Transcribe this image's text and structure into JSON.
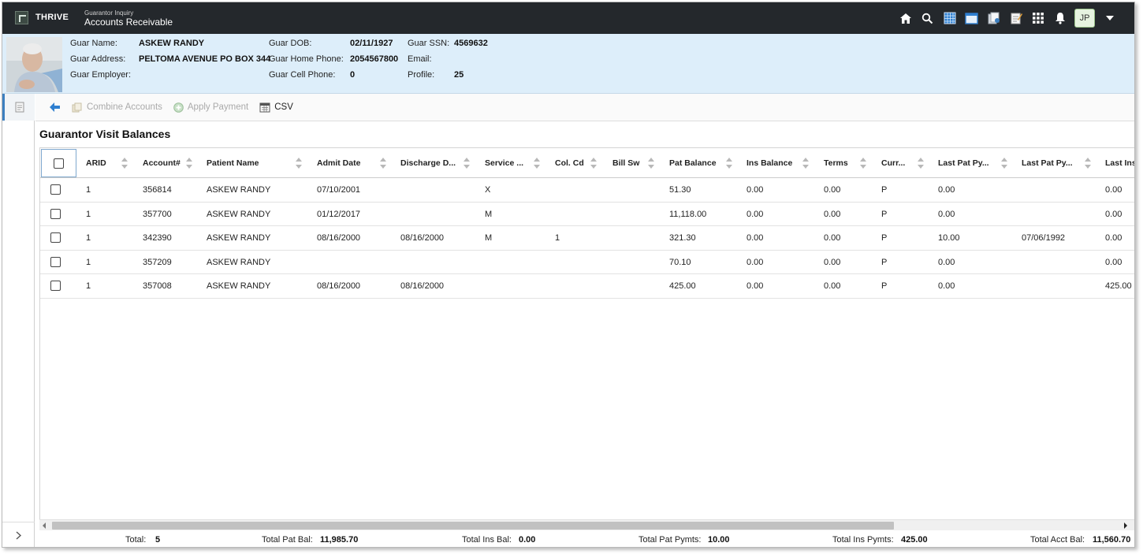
{
  "app": {
    "brand": "THRIVE",
    "subtitle": "Guarantor Inquiry",
    "title": "Accounts Receivable",
    "user_initials": "JP"
  },
  "top_icons": [
    "home-icon",
    "search-icon",
    "calendar-grid-icon",
    "window-icon",
    "documents-icon",
    "notes-icon",
    "apps-grid-icon",
    "bell-icon"
  ],
  "guarantor": {
    "name_label": "Guar Name:",
    "name": "ASKEW RANDY",
    "address_label": "Guar Address:",
    "address": "PELTOMA AVENUE PO BOX 344",
    "employer_label": "Guar Employer:",
    "employer": "",
    "dob_label": "Guar DOB:",
    "dob": "02/11/1927",
    "home_phone_label": "Guar Home Phone:",
    "home_phone": "2054567800",
    "cell_phone_label": "Guar Cell Phone:",
    "cell_phone": "0",
    "ssn_label": "Guar SSN:",
    "ssn": "4569632",
    "email_label": "Email:",
    "email": "",
    "profile_label": "Profile:",
    "profile": "25"
  },
  "toolbar": {
    "combine_label": "Combine Accounts",
    "apply_payment_label": "Apply Payment",
    "csv_label": "CSV"
  },
  "section_title": "Guarantor Visit Balances",
  "columns": [
    "ARID",
    "Account#",
    "Patient Name",
    "Admit Date",
    "Discharge D...",
    "Service ...",
    "Col. Cd",
    "Bill Sw",
    "Pat Balance",
    "Ins Balance",
    "Terms",
    "Curr...",
    "Last Pat Py...",
    "Last Pat Py...",
    "Last Ins"
  ],
  "rows": [
    [
      "1",
      "356814",
      "ASKEW RANDY",
      "07/10/2001",
      "",
      "X",
      "",
      "",
      "51.30",
      "0.00",
      "0.00",
      "P",
      "0.00",
      "",
      "0.00"
    ],
    [
      "1",
      "357700",
      "ASKEW RANDY",
      "01/12/2017",
      "",
      "M",
      "",
      "",
      "11,118.00",
      "0.00",
      "0.00",
      "P",
      "0.00",
      "",
      "0.00"
    ],
    [
      "1",
      "342390",
      "ASKEW RANDY",
      "08/16/2000",
      "08/16/2000",
      "M",
      "1",
      "",
      "321.30",
      "0.00",
      "0.00",
      "P",
      "10.00",
      "07/06/1992",
      "0.00"
    ],
    [
      "1",
      "357209",
      "ASKEW RANDY",
      "",
      "",
      "",
      "",
      "",
      "70.10",
      "0.00",
      "0.00",
      "P",
      "0.00",
      "",
      "0.00"
    ],
    [
      "1",
      "357008",
      "ASKEW RANDY",
      "08/16/2000",
      "08/16/2000",
      "",
      "",
      "",
      "425.00",
      "0.00",
      "0.00",
      "P",
      "0.00",
      "",
      "425.00"
    ]
  ],
  "footer": {
    "total_label": "Total:",
    "total": "5",
    "pat_bal_label": "Total Pat Bal:",
    "pat_bal": "11,985.70",
    "ins_bal_label": "Total Ins Bal:",
    "ins_bal": "0.00",
    "pat_pymts_label": "Total Pat Pymts:",
    "pat_pymts": "10.00",
    "ins_pymts_label": "Total Ins Pymts:",
    "ins_pymts": "425.00",
    "acct_bal_label": "Total Acct Bal:",
    "acct_bal": "11,560.70"
  },
  "colors": {
    "topbar": "#24282c",
    "header_bg": "#ddeefa",
    "accent": "#3c7fc0"
  }
}
